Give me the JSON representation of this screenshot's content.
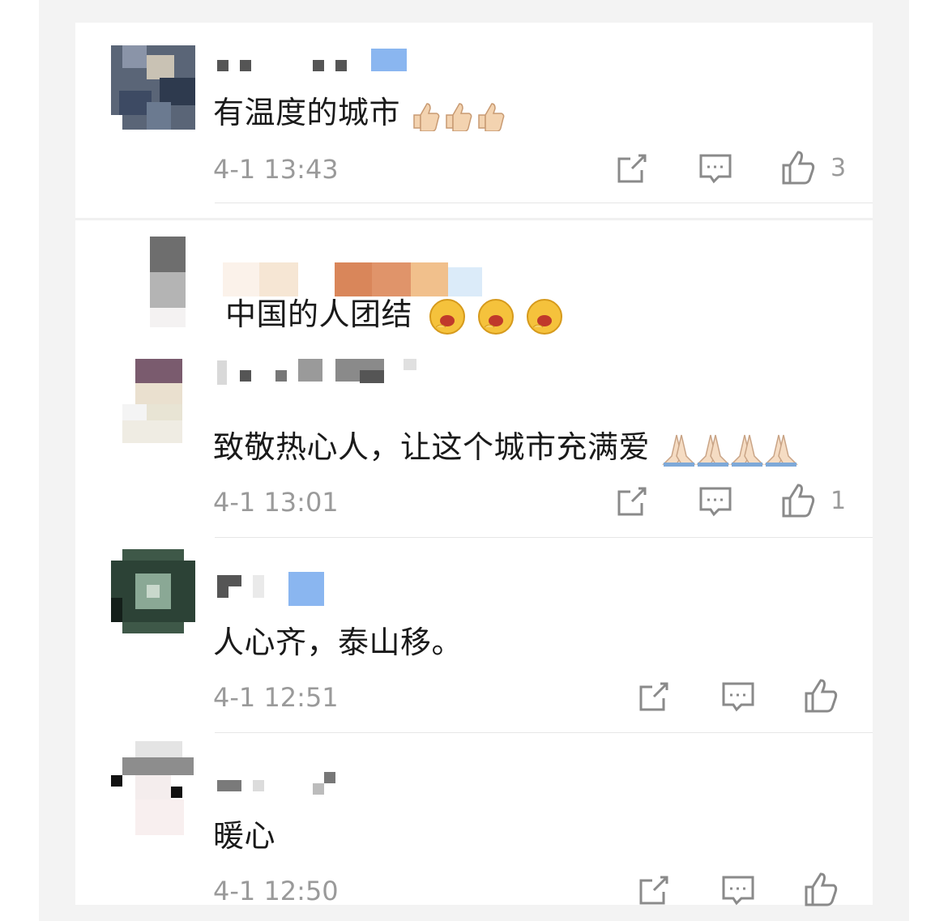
{
  "colors": {
    "meta_text": "#9a9a9a",
    "body_text": "#1a1a1a",
    "divider": "#e6e6e6"
  },
  "comments": [
    {
      "text": "有温度的城市",
      "emoji": "thumbs-up",
      "emoji_count": 3,
      "time": "4-1 13:43",
      "likes": "3"
    },
    {
      "text": "中国的人团结",
      "emoji": "hug-face",
      "emoji_count": 3
    },
    {
      "text": "致敬热心人，让这个城市充满爱",
      "emoji": "folded-hands",
      "emoji_count": 4,
      "time": "4-1 13:01",
      "likes": "1"
    },
    {
      "text": "人心齐，泰山移。",
      "time": "4-1 12:51"
    },
    {
      "text": "暖心",
      "time": "4-1 12:50"
    }
  ],
  "icons": {
    "share": "share-icon",
    "reply": "comment-icon",
    "like": "thumbs-up-icon"
  }
}
